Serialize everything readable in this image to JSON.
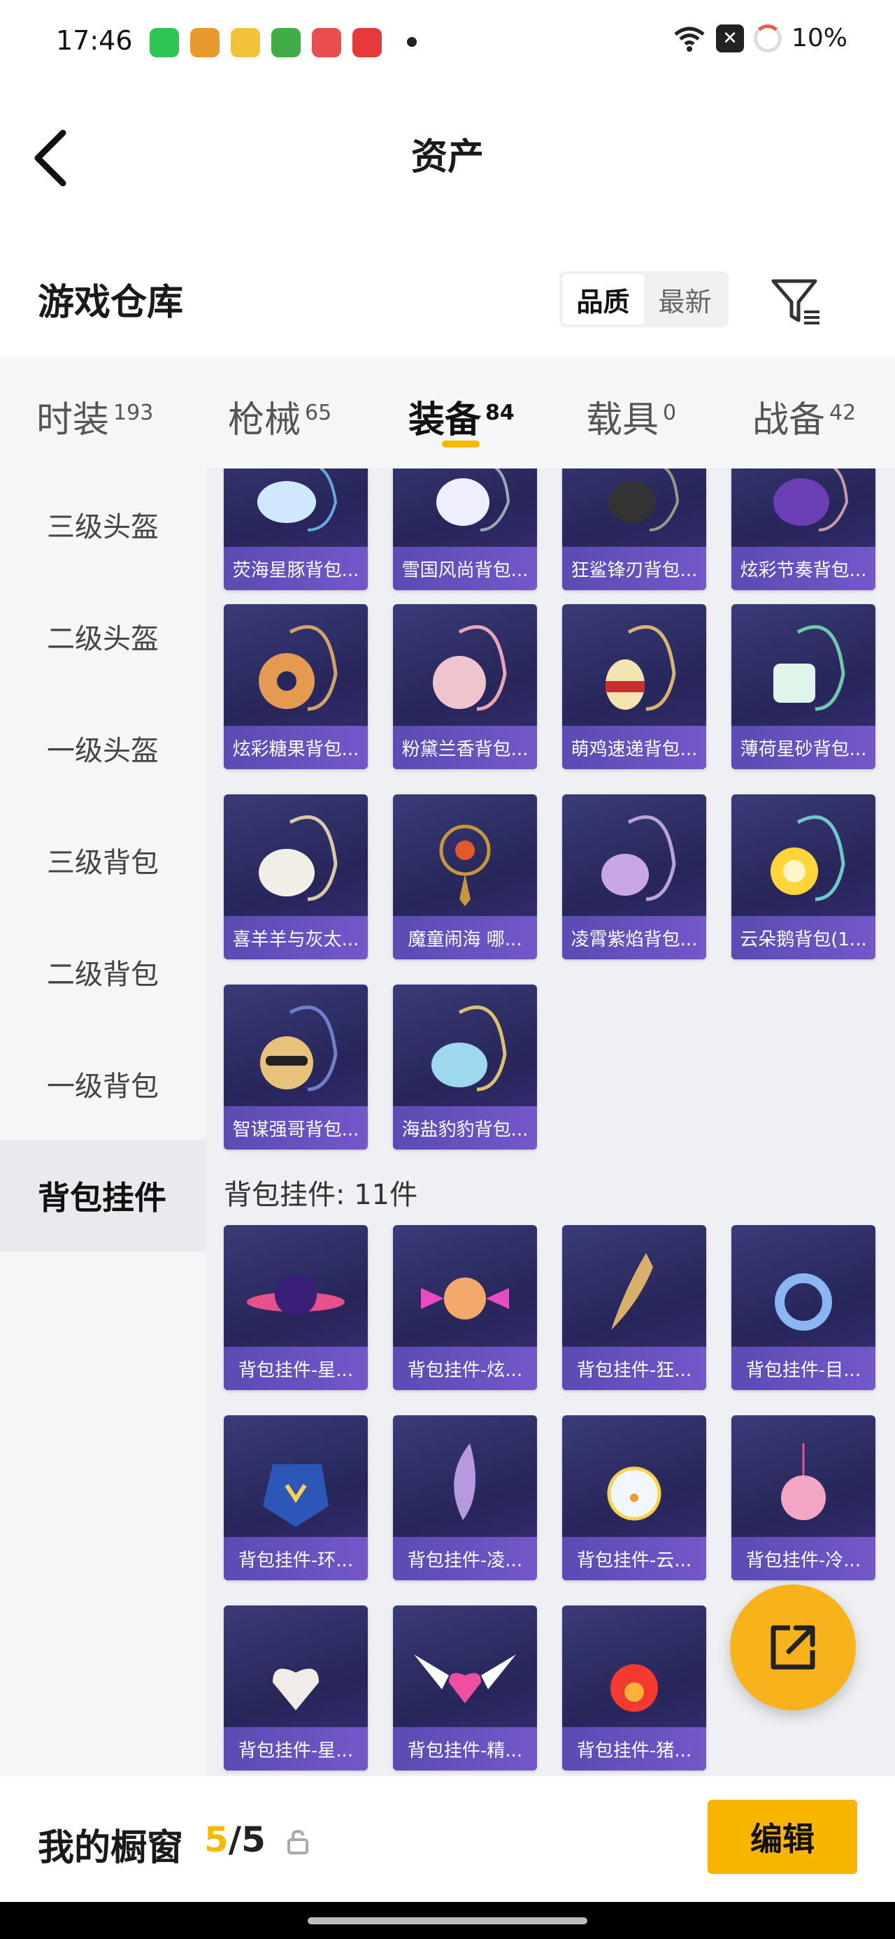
{
  "status_bar": {
    "time": "17:46",
    "battery": "10%"
  },
  "nav": {
    "title": "资产"
  },
  "section": {
    "title": "游戏仓库",
    "sort_options": [
      "品质",
      "最新"
    ]
  },
  "tabs": [
    {
      "label": "时装",
      "count": "193"
    },
    {
      "label": "枪械",
      "count": "65"
    },
    {
      "label": "装备",
      "count": "84"
    },
    {
      "label": "载具",
      "count": "0"
    },
    {
      "label": "战备",
      "count": "42"
    }
  ],
  "sidebar": [
    "三级头盔",
    "二级头盔",
    "一级头盔",
    "三级背包",
    "二级背包",
    "一级背包",
    "背包挂件"
  ],
  "backpacks": [
    "荧海星豚背包...",
    "雪国风尚背包...",
    "狂鲨锋刃背包...",
    "炫彩节奏背包...",
    "炫彩糖果背包...",
    "粉黛兰香背包...",
    "萌鸡速递背包...",
    "薄荷星砂背包...",
    "喜羊羊与灰太...",
    "魔童闹海 哪...",
    "凌霄紫焰背包...",
    "云朵鹅背包(1...",
    "智谋强哥背包...",
    "海盐豹豹背包..."
  ],
  "pendant_group": {
    "title": "背包挂件: 11件"
  },
  "pendants": [
    "背包挂件-星...",
    "背包挂件-炫...",
    "背包挂件-狂...",
    "背包挂件-目...",
    "背包挂件-环...",
    "背包挂件-凌...",
    "背包挂件-云...",
    "背包挂件-冷...",
    "背包挂件-星...",
    "背包挂件-精...",
    "背包挂件-猪..."
  ],
  "bottom": {
    "label": "我的橱窗",
    "current": "5",
    "sep": "/",
    "total": "5",
    "edit": "编辑"
  },
  "colors": {
    "accent": "#f6b900",
    "card_bg": "#2a2a62",
    "card_label": "#6a52c2"
  }
}
